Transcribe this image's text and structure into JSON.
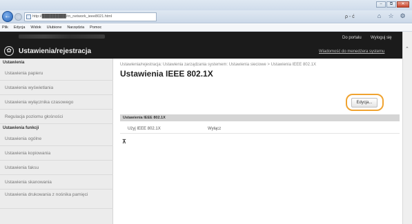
{
  "browser": {
    "address": "http://█████████/rn_network_ieee8021.html",
    "search_controls": "ρ - ć",
    "menu": [
      "Plik",
      "Edycja",
      "Widok",
      "Ulubione",
      "Narzędzia",
      "Pomoc"
    ]
  },
  "header": {
    "title": "Ustawienia/rejestracja",
    "to_portal": "Do portalu",
    "logout": "Wyloguj się",
    "admin_message": "Wiadomość do menedżera systemu"
  },
  "sidebar": {
    "section1": "Ustawienia",
    "items1": [
      "Ustawienia papieru",
      "Ustawienia wyświetlania",
      "Ustawienia wyłącznika czasowego",
      "Regulacja poziomu głośności"
    ],
    "section2": "Ustawienia funkcji",
    "items2": [
      "Ustawienia ogólne",
      "Ustawienia kopiowania",
      "Ustawienia faksu",
      "Ustawienia skanowania",
      "Ustawienia drukowania z nośnika pamięci"
    ]
  },
  "main": {
    "breadcrumb": "Ustawienia/rejestracja: Ustawienia zarządzania systemem: Ustawienia sieciowe > Ustawienia IEEE 802.1X",
    "title": "Ustawienia IEEE 802.1X",
    "edit_button": "Edycja...",
    "section_header": "Ustawienia IEEE 802.1X",
    "row_label": "Użyj IEEE 802.1X",
    "row_value": "Wyłącz"
  }
}
